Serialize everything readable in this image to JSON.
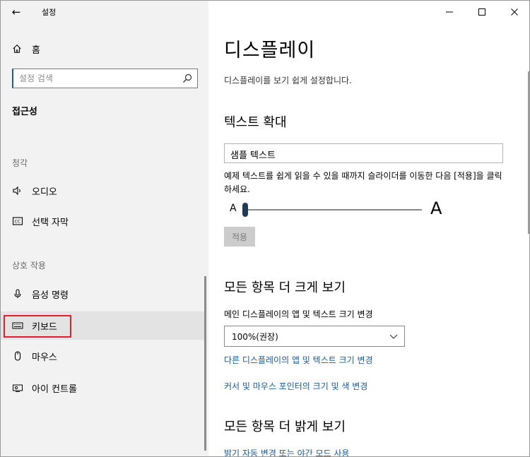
{
  "window": {
    "back_glyph": "←",
    "title": "설정",
    "controls": {
      "minimize": "minimize",
      "maximize": "maximize",
      "close": "close"
    }
  },
  "sidebar": {
    "home_label": "홈",
    "search_placeholder": "설정 검색",
    "category": "접근성",
    "groups": [
      {
        "label": "청각",
        "items": [
          {
            "label": "오디오",
            "icon": "speaker-icon"
          },
          {
            "label": "선택 자막",
            "icon": "closed-caption-icon"
          }
        ]
      },
      {
        "label": "상호 작용",
        "items": [
          {
            "label": "음성 명령",
            "icon": "microphone-icon"
          },
          {
            "label": "키보드",
            "icon": "keyboard-icon",
            "selected": true
          },
          {
            "label": "마우스",
            "icon": "mouse-icon"
          },
          {
            "label": "아이 컨트롤",
            "icon": "eye-control-icon"
          }
        ]
      }
    ],
    "highlight_color": "#e0202a"
  },
  "main": {
    "title": "디스플레이",
    "description": "디스플레이를 보기 쉽게 설정합니다.",
    "text_size": {
      "heading": "텍스트 확대",
      "sample": "샘플 텍스트",
      "instruction": "예제 텍스트를 쉽게 읽을 수 있을 때까지 슬라이더를 이동한 다음 [적용]을 클릭하세요.",
      "slider_min_label": "A",
      "slider_max_label": "A",
      "slider_value_fraction": 0.0,
      "apply_label": "적용"
    },
    "make_everything_bigger": {
      "heading": "모든 항목 더 크게 보기",
      "field_label": "메인 디스플레이의 앱 및 텍스트 크기 변경",
      "selected_value": "100%(권장)",
      "link_other_displays": "다른 디스플레이의 앱 및 텍스트 크기 변경",
      "link_pointer": "커서 및 마우스 포인터의 크기 및 색 변경"
    },
    "make_everything_brighter": {
      "heading": "모든 항목 더 밝게 보기",
      "link_night_mode": "밝기 자동 변경 또는 야간 모드 사용"
    }
  },
  "colors": {
    "accent": "#1f5a9e",
    "link": "#1a5a9a",
    "slider_thumb": "#1f3b57"
  }
}
